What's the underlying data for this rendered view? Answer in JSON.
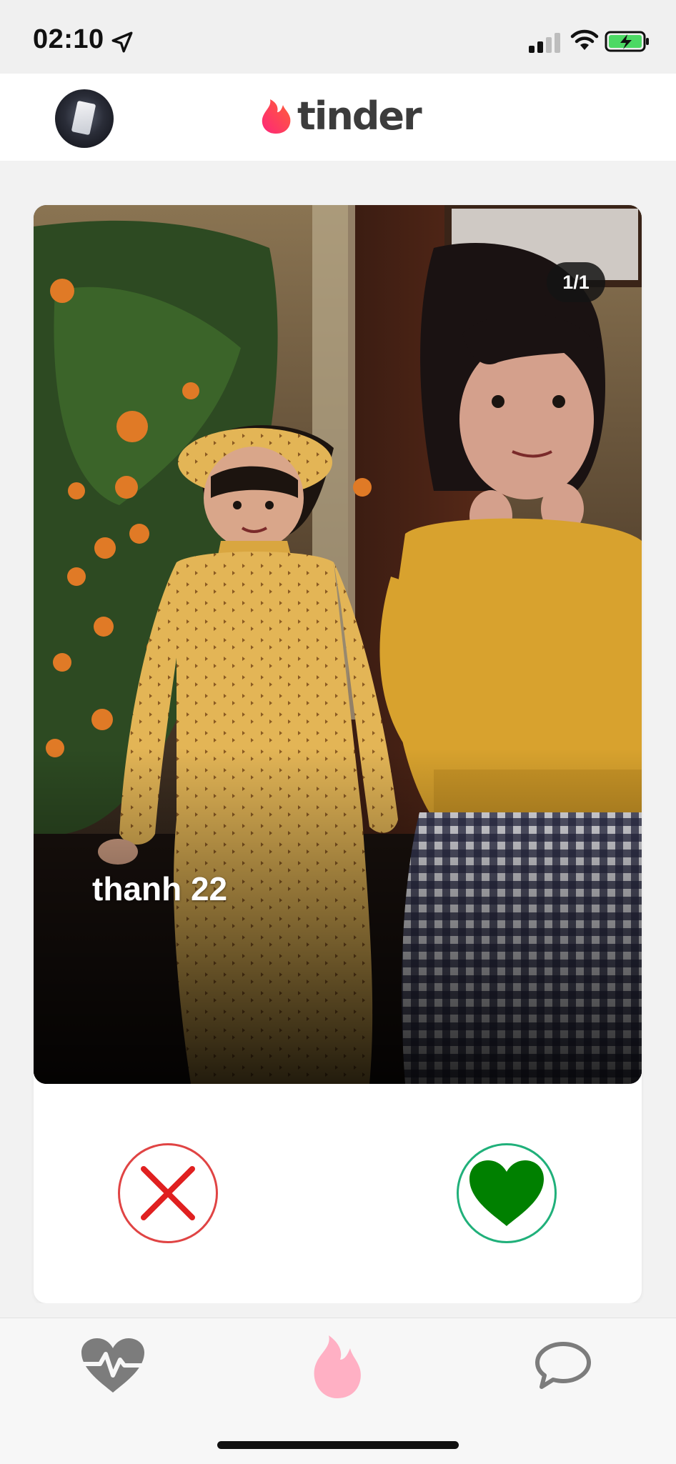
{
  "status_bar": {
    "time": "02:10",
    "icons": [
      "location-arrow-icon",
      "cellular-signal-icon",
      "wifi-icon",
      "battery-charging-icon"
    ]
  },
  "header": {
    "logo_text": "tinder",
    "brand_color": "#fe3c72"
  },
  "card": {
    "photo_counter": "1/1",
    "name_age": "thanh 22"
  },
  "actions": {
    "nope_icon": "x-icon",
    "nope_color": "#e02020",
    "like_icon": "heart-icon",
    "like_color": "#008000"
  },
  "bottom_nav": {
    "tabs": [
      "matches-heartbeat-icon",
      "discover-flame-icon",
      "messages-chat-icon"
    ],
    "active_tab": "discover-flame-icon"
  }
}
